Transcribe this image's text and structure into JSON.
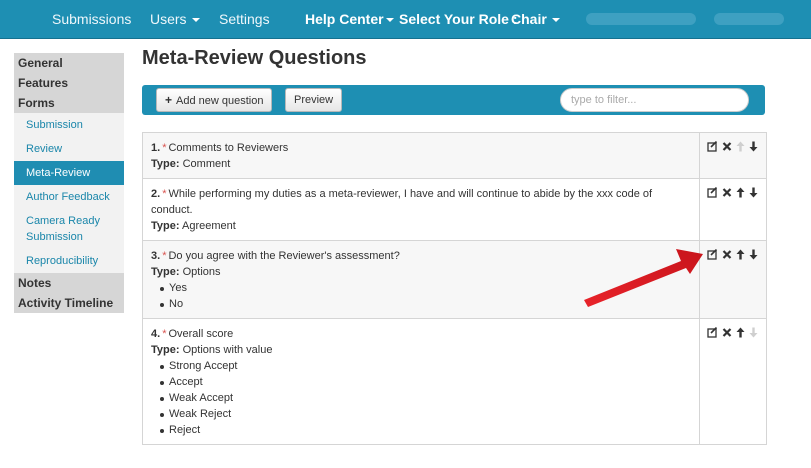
{
  "nav": {
    "submissions": "Submissions",
    "users": "Users",
    "settings": "Settings",
    "help_center": "Help Center",
    "role_label": "Select Your Role :",
    "role_value": "Chair"
  },
  "sidebar": {
    "general": "General",
    "features": "Features",
    "forms": "Forms",
    "form_items": [
      {
        "label": "Submission"
      },
      {
        "label": "Review"
      },
      {
        "label": "Meta-Review"
      },
      {
        "label": "Author Feedback"
      },
      {
        "label": "Camera Ready Submission"
      },
      {
        "label": "Reproducibility"
      }
    ],
    "notes": "Notes",
    "activity_timeline": "Activity Timeline",
    "active_item": "Meta-Review"
  },
  "page": {
    "title": "Meta-Review Questions"
  },
  "toolbar": {
    "add_label": "Add new question",
    "preview_label": "Preview",
    "filter_placeholder": "type to filter..."
  },
  "type_label": "Type:",
  "questions": [
    {
      "number": "1.",
      "required": "*",
      "text": "Comments to Reviewers",
      "type": "Comment",
      "options": []
    },
    {
      "number": "2.",
      "required": "*",
      "text": "While performing my duties as a meta-reviewer, I have and will continue to abide by the xxx code of conduct.",
      "type": "Agreement",
      "options": []
    },
    {
      "number": "3.",
      "required": "*",
      "text": "Do you agree with the Reviewer's assessment?",
      "type": "Options",
      "options": [
        "Yes",
        "No"
      ]
    },
    {
      "number": "4.",
      "required": "*",
      "text": "Overall score",
      "type": "Options with value",
      "options": [
        "Strong Accept",
        "Accept",
        "Weak Accept",
        "Weak Reject",
        "Reject"
      ]
    }
  ],
  "colors": {
    "nav_bg": "#1e8fb3",
    "active_bg": "#1f8db2",
    "link": "#1a86aa",
    "required": "#d9534f",
    "arrow": "#e8232a"
  },
  "icons": {
    "edit": "edit-icon",
    "delete": "delete-icon",
    "up": "arrow-up-icon",
    "down": "arrow-down-icon"
  }
}
